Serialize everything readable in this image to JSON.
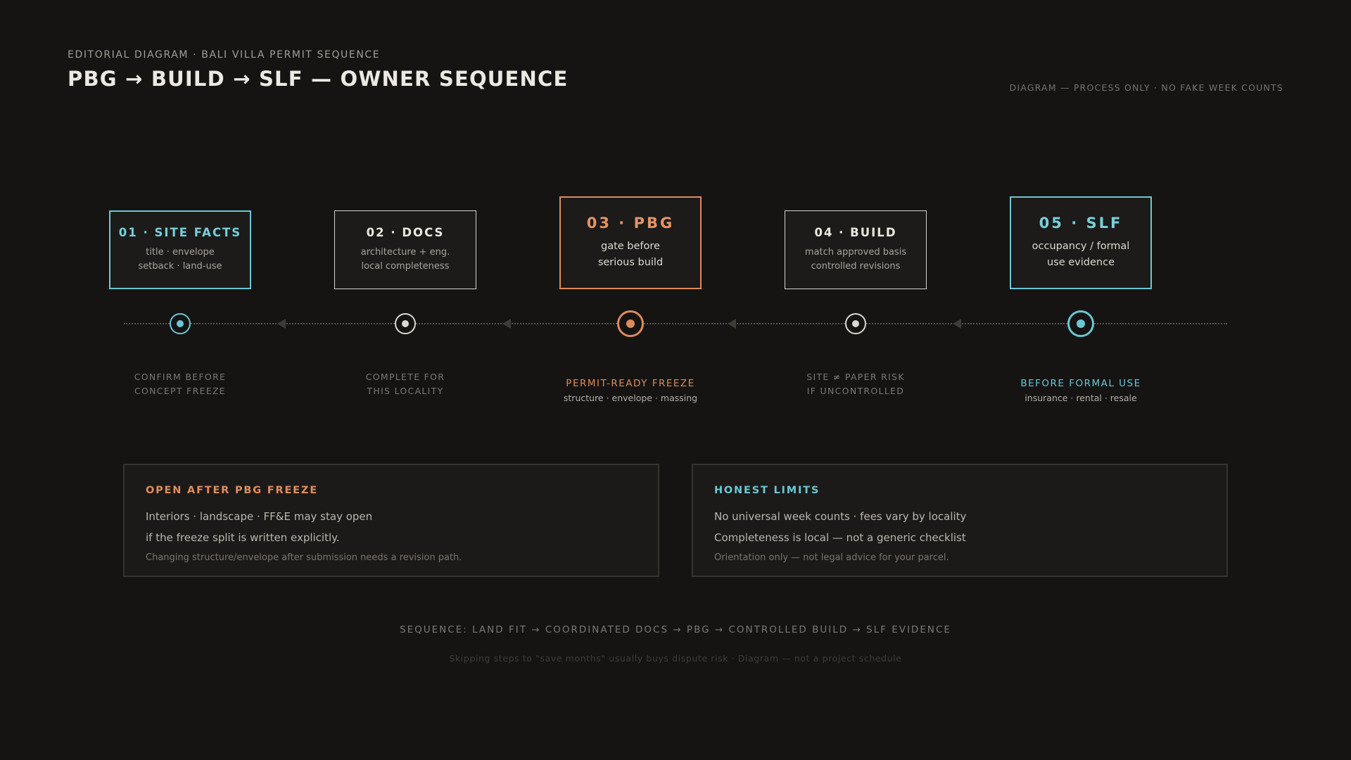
{
  "header": {
    "eyebrow": "EDITORIAL DIAGRAM · BALI VILLA PERMIT SEQUENCE",
    "title": "PBG → BUILD → SLF — OWNER SEQUENCE",
    "note": "DIAGRAM — PROCESS ONLY · NO FAKE WEEK COUNTS"
  },
  "steps": [
    {
      "title": "01 · SITE FACTS",
      "line1": "title · envelope",
      "line2": "setback · land-use",
      "caption1": "CONFIRM BEFORE",
      "caption2": "CONCEPT FREEZE"
    },
    {
      "title": "02 · DOCS",
      "line1": "architecture + eng.",
      "line2": "local completeness",
      "caption1": "COMPLETE FOR",
      "caption2": "THIS LOCALITY"
    },
    {
      "title": "03 · PBG",
      "line1": "gate before",
      "line2": "serious build",
      "caption1": "PERMIT-READY FREEZE",
      "caption2": "structure · envelope · massing"
    },
    {
      "title": "04 · BUILD",
      "line1": "match approved basis",
      "line2": "controlled revisions",
      "caption1": "SITE ≠ PAPER RISK",
      "caption2": "IF UNCONTROLLED"
    },
    {
      "title": "05 · SLF",
      "line1": "occupancy / formal",
      "line2": "use evidence",
      "caption1": "BEFORE FORMAL USE",
      "caption2": "insurance · rental · resale"
    }
  ],
  "panels": {
    "left": {
      "heading": "OPEN AFTER PBG FREEZE",
      "line1": "Interiors · landscape · FF&E may stay open",
      "line2": "if the freeze split is written explicitly.",
      "note": "Changing structure/envelope after submission needs a revision path."
    },
    "right": {
      "heading": "HONEST LIMITS",
      "line1": "No universal week counts · fees vary by locality",
      "line2": "Completeness is local — not a generic checklist",
      "note": "Orientation only — not legal advice for your parcel."
    }
  },
  "footer": {
    "sequence": "SEQUENCE: LAND FIT → COORDINATED DOCS → PBG → CONTROLLED BUILD → SLF EVIDENCE",
    "disclaimer": "Skipping steps to \"save months\" usually buys dispute risk · Diagram — not a project schedule"
  },
  "colors": {
    "background": "#151413",
    "accent_cyan": "#6cc6d4",
    "accent_orange": "#dd8b5c",
    "text_primary": "#ece8e2",
    "text_muted": "#7c7771"
  }
}
